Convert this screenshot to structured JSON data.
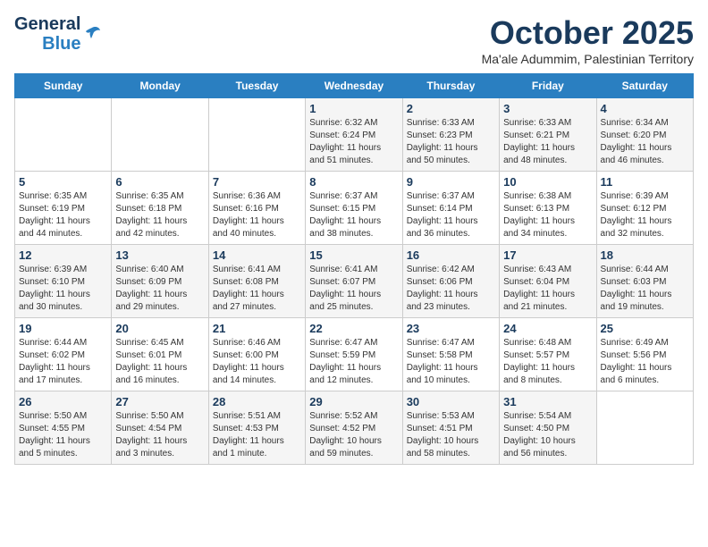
{
  "logo": {
    "general": "General",
    "blue": "Blue"
  },
  "header": {
    "month": "October 2025",
    "location": "Ma'ale Adummim, Palestinian Territory"
  },
  "weekdays": [
    "Sunday",
    "Monday",
    "Tuesday",
    "Wednesday",
    "Thursday",
    "Friday",
    "Saturday"
  ],
  "weeks": [
    [
      {
        "day": "",
        "info": ""
      },
      {
        "day": "",
        "info": ""
      },
      {
        "day": "",
        "info": ""
      },
      {
        "day": "1",
        "info": "Sunrise: 6:32 AM\nSunset: 6:24 PM\nDaylight: 11 hours\nand 51 minutes."
      },
      {
        "day": "2",
        "info": "Sunrise: 6:33 AM\nSunset: 6:23 PM\nDaylight: 11 hours\nand 50 minutes."
      },
      {
        "day": "3",
        "info": "Sunrise: 6:33 AM\nSunset: 6:21 PM\nDaylight: 11 hours\nand 48 minutes."
      },
      {
        "day": "4",
        "info": "Sunrise: 6:34 AM\nSunset: 6:20 PM\nDaylight: 11 hours\nand 46 minutes."
      }
    ],
    [
      {
        "day": "5",
        "info": "Sunrise: 6:35 AM\nSunset: 6:19 PM\nDaylight: 11 hours\nand 44 minutes."
      },
      {
        "day": "6",
        "info": "Sunrise: 6:35 AM\nSunset: 6:18 PM\nDaylight: 11 hours\nand 42 minutes."
      },
      {
        "day": "7",
        "info": "Sunrise: 6:36 AM\nSunset: 6:16 PM\nDaylight: 11 hours\nand 40 minutes."
      },
      {
        "day": "8",
        "info": "Sunrise: 6:37 AM\nSunset: 6:15 PM\nDaylight: 11 hours\nand 38 minutes."
      },
      {
        "day": "9",
        "info": "Sunrise: 6:37 AM\nSunset: 6:14 PM\nDaylight: 11 hours\nand 36 minutes."
      },
      {
        "day": "10",
        "info": "Sunrise: 6:38 AM\nSunset: 6:13 PM\nDaylight: 11 hours\nand 34 minutes."
      },
      {
        "day": "11",
        "info": "Sunrise: 6:39 AM\nSunset: 6:12 PM\nDaylight: 11 hours\nand 32 minutes."
      }
    ],
    [
      {
        "day": "12",
        "info": "Sunrise: 6:39 AM\nSunset: 6:10 PM\nDaylight: 11 hours\nand 30 minutes."
      },
      {
        "day": "13",
        "info": "Sunrise: 6:40 AM\nSunset: 6:09 PM\nDaylight: 11 hours\nand 29 minutes."
      },
      {
        "day": "14",
        "info": "Sunrise: 6:41 AM\nSunset: 6:08 PM\nDaylight: 11 hours\nand 27 minutes."
      },
      {
        "day": "15",
        "info": "Sunrise: 6:41 AM\nSunset: 6:07 PM\nDaylight: 11 hours\nand 25 minutes."
      },
      {
        "day": "16",
        "info": "Sunrise: 6:42 AM\nSunset: 6:06 PM\nDaylight: 11 hours\nand 23 minutes."
      },
      {
        "day": "17",
        "info": "Sunrise: 6:43 AM\nSunset: 6:04 PM\nDaylight: 11 hours\nand 21 minutes."
      },
      {
        "day": "18",
        "info": "Sunrise: 6:44 AM\nSunset: 6:03 PM\nDaylight: 11 hours\nand 19 minutes."
      }
    ],
    [
      {
        "day": "19",
        "info": "Sunrise: 6:44 AM\nSunset: 6:02 PM\nDaylight: 11 hours\nand 17 minutes."
      },
      {
        "day": "20",
        "info": "Sunrise: 6:45 AM\nSunset: 6:01 PM\nDaylight: 11 hours\nand 16 minutes."
      },
      {
        "day": "21",
        "info": "Sunrise: 6:46 AM\nSunset: 6:00 PM\nDaylight: 11 hours\nand 14 minutes."
      },
      {
        "day": "22",
        "info": "Sunrise: 6:47 AM\nSunset: 5:59 PM\nDaylight: 11 hours\nand 12 minutes."
      },
      {
        "day": "23",
        "info": "Sunrise: 6:47 AM\nSunset: 5:58 PM\nDaylight: 11 hours\nand 10 minutes."
      },
      {
        "day": "24",
        "info": "Sunrise: 6:48 AM\nSunset: 5:57 PM\nDaylight: 11 hours\nand 8 minutes."
      },
      {
        "day": "25",
        "info": "Sunrise: 6:49 AM\nSunset: 5:56 PM\nDaylight: 11 hours\nand 6 minutes."
      }
    ],
    [
      {
        "day": "26",
        "info": "Sunrise: 5:50 AM\nSunset: 4:55 PM\nDaylight: 11 hours\nand 5 minutes."
      },
      {
        "day": "27",
        "info": "Sunrise: 5:50 AM\nSunset: 4:54 PM\nDaylight: 11 hours\nand 3 minutes."
      },
      {
        "day": "28",
        "info": "Sunrise: 5:51 AM\nSunset: 4:53 PM\nDaylight: 11 hours\nand 1 minute."
      },
      {
        "day": "29",
        "info": "Sunrise: 5:52 AM\nSunset: 4:52 PM\nDaylight: 10 hours\nand 59 minutes."
      },
      {
        "day": "30",
        "info": "Sunrise: 5:53 AM\nSunset: 4:51 PM\nDaylight: 10 hours\nand 58 minutes."
      },
      {
        "day": "31",
        "info": "Sunrise: 5:54 AM\nSunset: 4:50 PM\nDaylight: 10 hours\nand 56 minutes."
      },
      {
        "day": "",
        "info": ""
      }
    ]
  ]
}
